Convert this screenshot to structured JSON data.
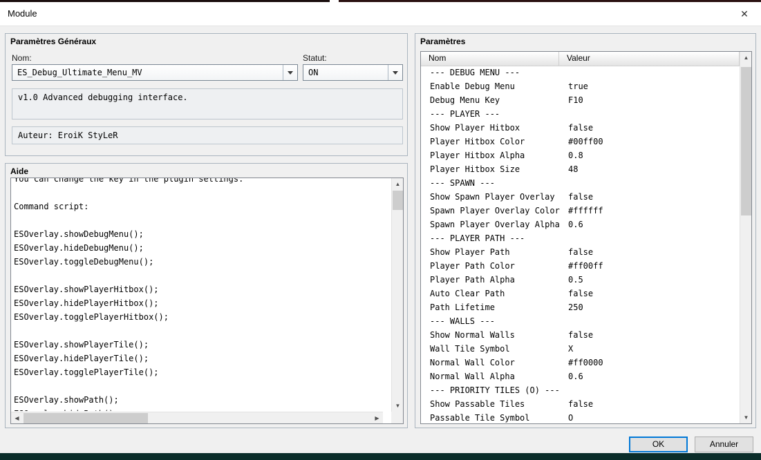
{
  "window": {
    "title": "Module",
    "close_icon": "✕"
  },
  "general": {
    "title": "Paramètres Généraux",
    "name_label": "Nom:",
    "name_value": "ES_Debug_Ultimate_Menu_MV",
    "status_label": "Statut:",
    "status_value": "ON",
    "description": "v1.0 Advanced debugging interface.",
    "author": "Auteur: EroiK StyLeR"
  },
  "help": {
    "title": "Aide",
    "lines": [
      "You can change the key in the plugin settings.",
      "",
      "Command script:",
      "",
      "ESOverlay.showDebugMenu();",
      "ESOverlay.hideDebugMenu();",
      "ESOverlay.toggleDebugMenu();",
      "",
      "ESOverlay.showPlayerHitbox();",
      "ESOverlay.hidePlayerHitbox();",
      "ESOverlay.togglePlayerHitbox();",
      "",
      "ESOverlay.showPlayerTile();",
      "ESOverlay.hidePlayerTile();",
      "ESOverlay.togglePlayerTile();",
      "",
      "ESOverlay.showPath();",
      "ESOverlay.hidePath();"
    ]
  },
  "params": {
    "title": "Paramètres",
    "columns": {
      "name": "Nom",
      "value": "Valeur"
    },
    "rows": [
      {
        "name": "--- DEBUG MENU ---",
        "value": ""
      },
      {
        "name": "Enable Debug Menu",
        "value": "true"
      },
      {
        "name": "Debug Menu Key",
        "value": "F10"
      },
      {
        "name": "--- PLAYER ---",
        "value": ""
      },
      {
        "name": "Show Player Hitbox",
        "value": "false"
      },
      {
        "name": "Player Hitbox Color",
        "value": "#00ff00"
      },
      {
        "name": "Player Hitbox Alpha",
        "value": "0.8"
      },
      {
        "name": "Player Hitbox Size",
        "value": "48"
      },
      {
        "name": "--- SPAWN ---",
        "value": ""
      },
      {
        "name": "Show Spawn Player Overlay",
        "value": "false"
      },
      {
        "name": "Spawn Player Overlay Color",
        "value": "#ffffff"
      },
      {
        "name": "Spawn Player Overlay Alpha",
        "value": "0.6"
      },
      {
        "name": "--- PLAYER PATH ---",
        "value": ""
      },
      {
        "name": "Show Player Path",
        "value": "false"
      },
      {
        "name": "Player Path Color",
        "value": "#ff00ff"
      },
      {
        "name": "Player Path Alpha",
        "value": "0.5"
      },
      {
        "name": "Auto Clear Path",
        "value": "false"
      },
      {
        "name": "Path Lifetime",
        "value": "250"
      },
      {
        "name": "--- WALLS ---",
        "value": ""
      },
      {
        "name": "Show Normal Walls",
        "value": "false"
      },
      {
        "name": "Wall Tile Symbol",
        "value": "X"
      },
      {
        "name": "Normal Wall Color",
        "value": "#ff0000"
      },
      {
        "name": "Normal Wall Alpha",
        "value": "0.6"
      },
      {
        "name": "--- PRIORITY TILES (O) ---",
        "value": ""
      },
      {
        "name": "Show Passable Tiles",
        "value": "false"
      },
      {
        "name": "Passable Tile Symbol",
        "value": "O"
      }
    ]
  },
  "footer": {
    "ok": "OK",
    "cancel": "Annuler"
  },
  "colors": {
    "accent": "#0078d7",
    "bottom_strip": "#0b2d2a"
  }
}
